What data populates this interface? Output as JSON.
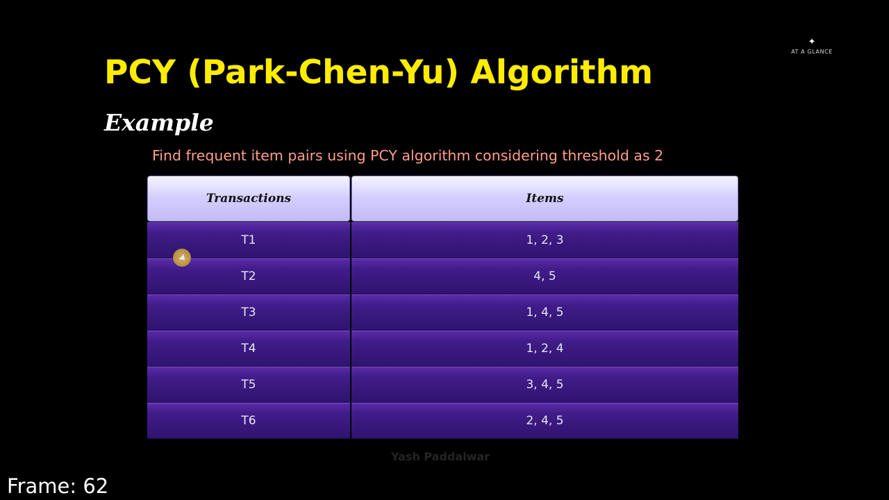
{
  "logo": {
    "icon": "sparkle-icon",
    "text": "AT A GLANCE"
  },
  "slide": {
    "title": "PCY (Park-Chen-Yu) Algorithm",
    "subtitle": "Example",
    "instruction": "Find frequent item pairs using PCY algorithm considering threshold as 2"
  },
  "table": {
    "headers": [
      "Transactions",
      "Items"
    ],
    "rows": [
      {
        "transaction": "T1",
        "items": "1, 2, 3"
      },
      {
        "transaction": "T2",
        "items": "4, 5"
      },
      {
        "transaction": "T3",
        "items": "1, 4, 5"
      },
      {
        "transaction": "T4",
        "items": "1, 2, 4"
      },
      {
        "transaction": "T5",
        "items": "3, 4, 5"
      },
      {
        "transaction": "T6",
        "items": "2, 4, 5"
      }
    ]
  },
  "watermark": "Yash Paddalwar",
  "frame": "Frame:  62",
  "colors": {
    "title": "#ffec00",
    "instruction": "#ff9e8c",
    "header_cell": "#d4ceff",
    "body_cell": "#401c88",
    "background": "#000000"
  }
}
